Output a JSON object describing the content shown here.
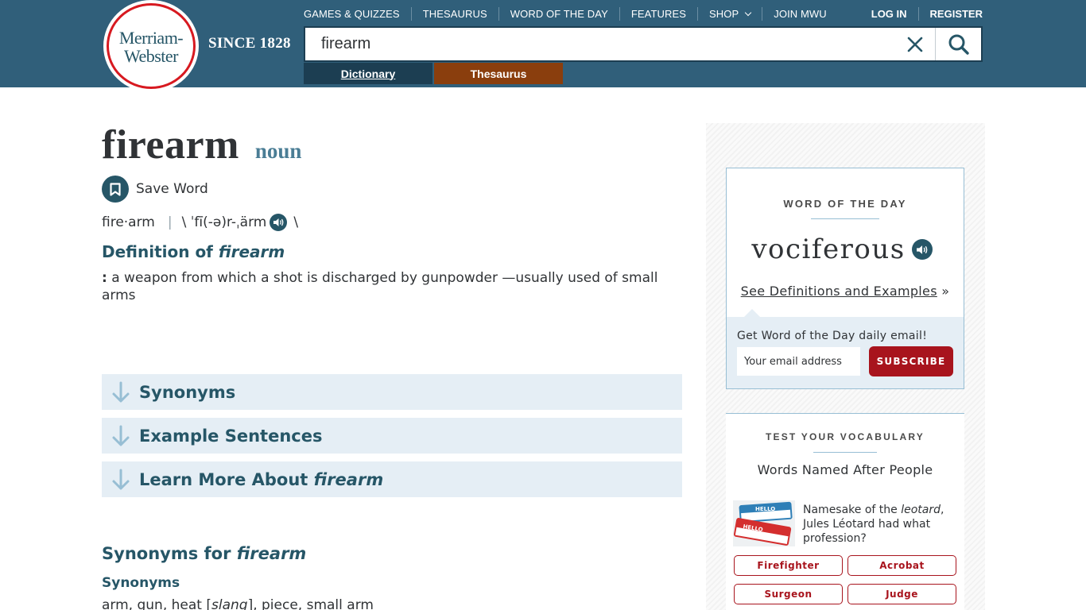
{
  "header": {
    "logo_line1": "Merriam-",
    "logo_line2": "Webster",
    "since": "SINCE 1828",
    "nav": [
      {
        "label": "GAMES & QUIZZES"
      },
      {
        "label": "THESAURUS"
      },
      {
        "label": "WORD OF THE DAY"
      },
      {
        "label": "FEATURES"
      },
      {
        "label": "SHOP"
      },
      {
        "label": "JOIN MWU"
      }
    ],
    "login": "LOG IN",
    "register": "REGISTER",
    "search_value": "firearm",
    "tabs": {
      "dictionary": "Dictionary",
      "thesaurus": "Thesaurus"
    }
  },
  "entry": {
    "headword": "firearm",
    "pos": "noun",
    "save_label": "Save Word",
    "syllables": "fire·arm",
    "pron_sep": "|",
    "pron_open": "\\ ˈfī(-ə)r-ˌärm",
    "pron_close": "\\",
    "def_prefix": "Definition of ",
    "def_word": "firearm",
    "def_colon": ":",
    "def_text": " a weapon from which a shot is discharged by gunpowder —usually used of small arms"
  },
  "accordions": [
    {
      "label": "Synonyms",
      "italic": ""
    },
    {
      "label": "Example Sentences",
      "italic": ""
    },
    {
      "label": "Learn More About ",
      "italic": "firearm"
    }
  ],
  "synonyms": {
    "heading_prefix": "Synonyms for ",
    "heading_word": "firearm",
    "sub": "Synonyms",
    "list_a": "arm, gun, heat [",
    "list_slang": "slang",
    "list_b": "], piece, small arm"
  },
  "wotd": {
    "title": "WORD OF THE DAY",
    "word": "vociferous",
    "link": "See Definitions and Examples",
    "link_suffix": " »",
    "email_label": "Get Word of the Day daily email!",
    "email_placeholder": "Your email address",
    "subscribe": "SUBSCRIBE"
  },
  "vocab": {
    "title": "TEST YOUR VOCABULARY",
    "subtitle": "Words Named After People",
    "q_a": "Namesake of the ",
    "q_italic": "leotard",
    "q_b": ", Jules Léotard had what profession?",
    "answers": [
      "Firefighter",
      "Acrobat",
      "Surgeon",
      "Judge"
    ],
    "img_text": "HELLO"
  },
  "colors": {
    "header_bg": "#305f7a",
    "accent_blue": "#265667",
    "accent_red": "#a8141d",
    "thesaurus_tab": "#8a3e0d",
    "light_blue": "#e5eef5"
  }
}
